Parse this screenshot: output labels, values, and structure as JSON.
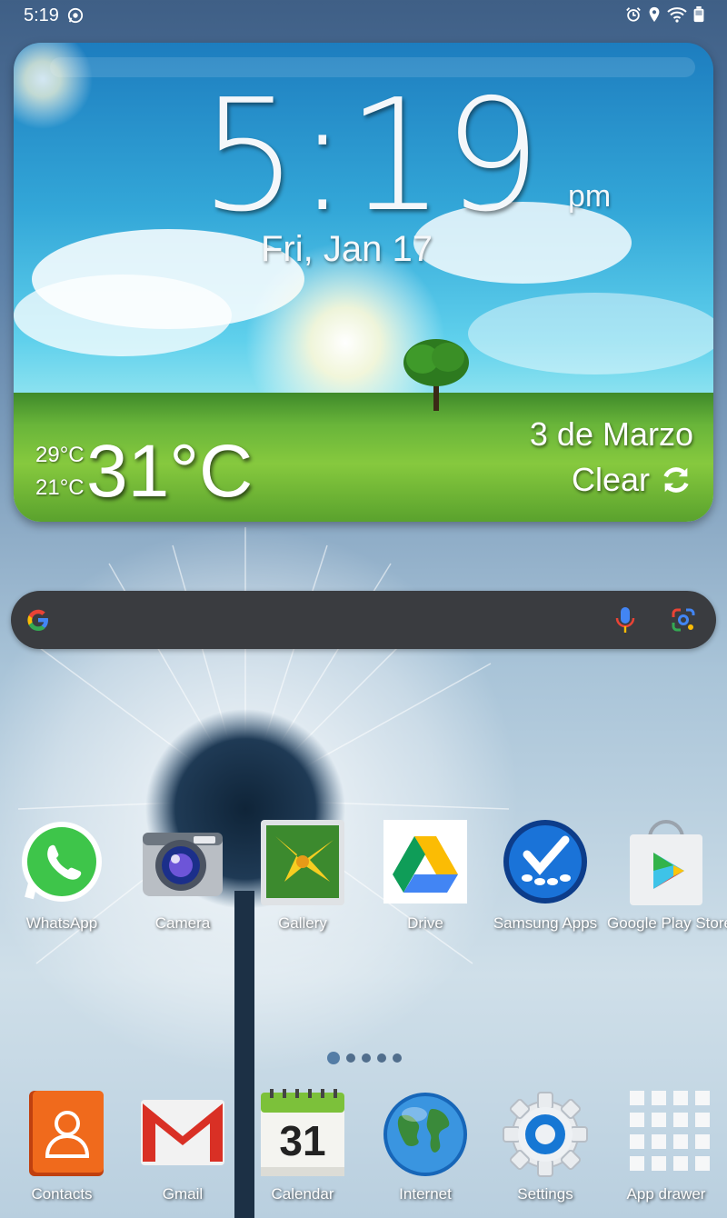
{
  "status_bar": {
    "time": "5:19",
    "icons": [
      "whatsapp-icon",
      "alarm-icon",
      "location-icon",
      "wifi-icon",
      "battery-icon"
    ]
  },
  "clock_widget": {
    "time": "5:19",
    "ampm": "pm",
    "date": "Fri, Jan 17",
    "temp_high": "29°C",
    "temp_low": "21°C",
    "temperature": "31°C",
    "weather_date": "3 de Marzo",
    "condition": "Clear"
  },
  "search": {
    "placeholder": "",
    "icons": [
      "google-g-icon",
      "microphone-icon",
      "google-lens-icon"
    ]
  },
  "apps": [
    {
      "label": "WhatsApp",
      "icon": "whatsapp-icon"
    },
    {
      "label": "Camera",
      "icon": "camera-icon"
    },
    {
      "label": "Gallery",
      "icon": "gallery-icon"
    },
    {
      "label": "Drive",
      "icon": "drive-icon"
    },
    {
      "label": "Samsung Apps",
      "icon": "samsung-apps-icon"
    },
    {
      "label": "Google Play Store",
      "icon": "play-store-icon"
    }
  ],
  "page_indicator": {
    "pages": 5,
    "current": 1
  },
  "dock": [
    {
      "label": "Contacts",
      "icon": "contacts-icon"
    },
    {
      "label": "Gmail",
      "icon": "gmail-icon"
    },
    {
      "label": "Calendar",
      "icon": "calendar-icon",
      "day": "31"
    },
    {
      "label": "Internet",
      "icon": "internet-icon"
    },
    {
      "label": "Settings",
      "icon": "settings-icon"
    },
    {
      "label": "App drawer",
      "icon": "app-drawer-icon"
    }
  ],
  "colors": {
    "search_bg": "#3a3c40",
    "wallpaper_top": "#3f5f86",
    "wallpaper_bottom": "#cfdfe9"
  }
}
